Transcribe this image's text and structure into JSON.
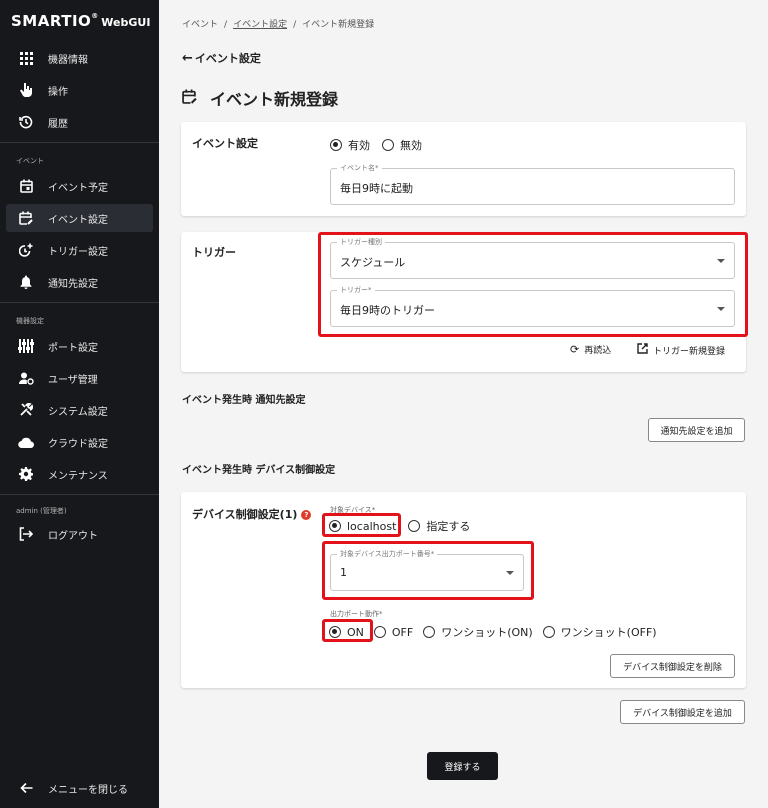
{
  "app": {
    "brand": "SMARTIO",
    "reg": "®",
    "suffix": "WebGUI"
  },
  "sidebar": {
    "items_top": [
      {
        "label": "機器情報",
        "icon": "grid-icon"
      },
      {
        "label": "操作",
        "icon": "pointer-icon"
      },
      {
        "label": "履歴",
        "icon": "history-icon"
      }
    ],
    "section_event": "イベント",
    "items_event": [
      {
        "label": "イベント予定",
        "icon": "calendar-icon"
      },
      {
        "label": "イベント設定",
        "icon": "calendar-edit-icon"
      },
      {
        "label": "トリガー設定",
        "icon": "timer-plus-icon"
      },
      {
        "label": "通知先設定",
        "icon": "bell-icon"
      }
    ],
    "section_device": "機器設定",
    "items_device": [
      {
        "label": "ポート設定",
        "icon": "sliders-icon"
      },
      {
        "label": "ユーザ管理",
        "icon": "user-gear-icon"
      },
      {
        "label": "システム設定",
        "icon": "tools-icon"
      },
      {
        "label": "クラウド設定",
        "icon": "cloud-icon"
      },
      {
        "label": "メンテナンス",
        "icon": "gear-icon"
      }
    ],
    "section_user": "admin (管理者)",
    "logout": "ログアウト",
    "close_menu": "メニューを閉じる"
  },
  "breadcrumb": {
    "root": "イベント",
    "parent": "イベント設定",
    "current": "イベント新規登録"
  },
  "back_label": "イベント設定",
  "page_title": "イベント新規登録",
  "event_card": {
    "label": "イベント設定",
    "enabled": "有効",
    "disabled": "無効",
    "name_label": "イベント名*",
    "name_value": "毎日9時に起動"
  },
  "trigger_card": {
    "label": "トリガー",
    "type_label": "トリガー種別",
    "type_value": "スケジュール",
    "trigger_label": "トリガー*",
    "trigger_value": "毎日9時のトリガー",
    "reload": "再読込",
    "new_trigger": "トリガー新規登録"
  },
  "notify_section": {
    "heading": "イベント発生時 通知先設定",
    "add_button": "通知先設定を追加"
  },
  "device_section": {
    "heading": "イベント発生時 デバイス制御設定",
    "card_label": "デバイス制御設定(1)",
    "help": "?",
    "target_label": "対象デバイス*",
    "target_localhost": "localhost",
    "target_specify": "指定する",
    "port_label": "対象デバイス出力ポート番号*",
    "port_value": "1",
    "action_label": "出力ポート動作*",
    "actions": [
      "ON",
      "OFF",
      "ワンショット(ON)",
      "ワンショット(OFF)"
    ],
    "delete_button": "デバイス制御設定を削除",
    "add_button": "デバイス制御設定を追加"
  },
  "submit": "登録する"
}
